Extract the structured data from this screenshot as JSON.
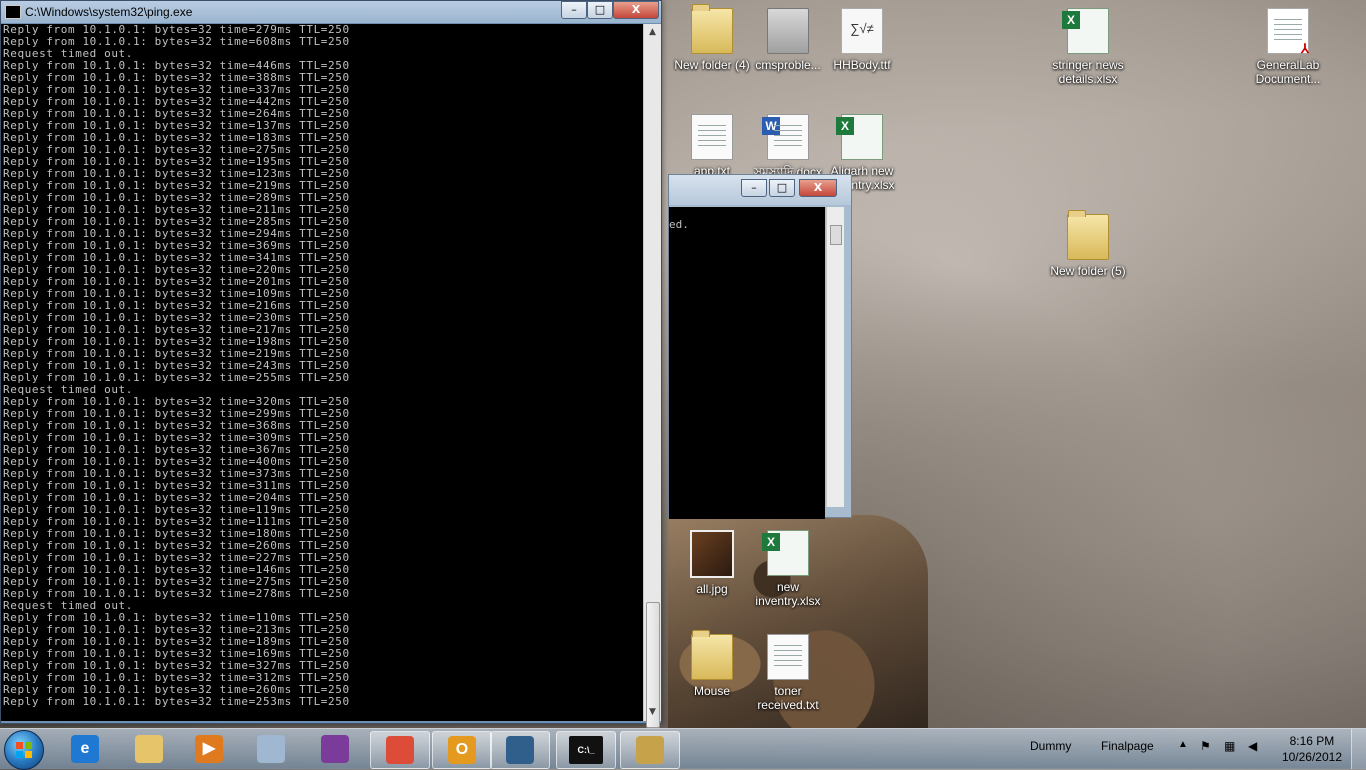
{
  "main_window": {
    "title": "C:\\Windows\\system32\\ping.exe",
    "minimize": "–",
    "maximize": "□",
    "close": "X",
    "lines": [
      "Reply from 10.1.0.1: bytes=32 time=279ms TTL=250",
      "Reply from 10.1.0.1: bytes=32 time=608ms TTL=250",
      "Request timed out.",
      "Reply from 10.1.0.1: bytes=32 time=446ms TTL=250",
      "Reply from 10.1.0.1: bytes=32 time=388ms TTL=250",
      "Reply from 10.1.0.1: bytes=32 time=337ms TTL=250",
      "Reply from 10.1.0.1: bytes=32 time=442ms TTL=250",
      "Reply from 10.1.0.1: bytes=32 time=264ms TTL=250",
      "Reply from 10.1.0.1: bytes=32 time=137ms TTL=250",
      "Reply from 10.1.0.1: bytes=32 time=183ms TTL=250",
      "Reply from 10.1.0.1: bytes=32 time=275ms TTL=250",
      "Reply from 10.1.0.1: bytes=32 time=195ms TTL=250",
      "Reply from 10.1.0.1: bytes=32 time=123ms TTL=250",
      "Reply from 10.1.0.1: bytes=32 time=219ms TTL=250",
      "Reply from 10.1.0.1: bytes=32 time=289ms TTL=250",
      "Reply from 10.1.0.1: bytes=32 time=211ms TTL=250",
      "Reply from 10.1.0.1: bytes=32 time=285ms TTL=250",
      "Reply from 10.1.0.1: bytes=32 time=294ms TTL=250",
      "Reply from 10.1.0.1: bytes=32 time=369ms TTL=250",
      "Reply from 10.1.0.1: bytes=32 time=341ms TTL=250",
      "Reply from 10.1.0.1: bytes=32 time=220ms TTL=250",
      "Reply from 10.1.0.1: bytes=32 time=201ms TTL=250",
      "Reply from 10.1.0.1: bytes=32 time=109ms TTL=250",
      "Reply from 10.1.0.1: bytes=32 time=216ms TTL=250",
      "Reply from 10.1.0.1: bytes=32 time=230ms TTL=250",
      "Reply from 10.1.0.1: bytes=32 time=217ms TTL=250",
      "Reply from 10.1.0.1: bytes=32 time=198ms TTL=250",
      "Reply from 10.1.0.1: bytes=32 time=219ms TTL=250",
      "Reply from 10.1.0.1: bytes=32 time=243ms TTL=250",
      "Reply from 10.1.0.1: bytes=32 time=255ms TTL=250",
      "Request timed out.",
      "Reply from 10.1.0.1: bytes=32 time=320ms TTL=250",
      "Reply from 10.1.0.1: bytes=32 time=299ms TTL=250",
      "Reply from 10.1.0.1: bytes=32 time=368ms TTL=250",
      "Reply from 10.1.0.1: bytes=32 time=309ms TTL=250",
      "Reply from 10.1.0.1: bytes=32 time=367ms TTL=250",
      "Reply from 10.1.0.1: bytes=32 time=400ms TTL=250",
      "Reply from 10.1.0.1: bytes=32 time=373ms TTL=250",
      "Reply from 10.1.0.1: bytes=32 time=311ms TTL=250",
      "Reply from 10.1.0.1: bytes=32 time=204ms TTL=250",
      "Reply from 10.1.0.1: bytes=32 time=119ms TTL=250",
      "Reply from 10.1.0.1: bytes=32 time=111ms TTL=250",
      "Reply from 10.1.0.1: bytes=32 time=180ms TTL=250",
      "Reply from 10.1.0.1: bytes=32 time=260ms TTL=250",
      "Reply from 10.1.0.1: bytes=32 time=227ms TTL=250",
      "Reply from 10.1.0.1: bytes=32 time=146ms TTL=250",
      "Reply from 10.1.0.1: bytes=32 time=275ms TTL=250",
      "Reply from 10.1.0.1: bytes=32 time=278ms TTL=250",
      "Request timed out.",
      "Reply from 10.1.0.1: bytes=32 time=110ms TTL=250",
      "Reply from 10.1.0.1: bytes=32 time=213ms TTL=250",
      "Reply from 10.1.0.1: bytes=32 time=189ms TTL=250",
      "Reply from 10.1.0.1: bytes=32 time=169ms TTL=250",
      "Reply from 10.1.0.1: bytes=32 time=327ms TTL=250",
      "Reply from 10.1.0.1: bytes=32 time=312ms TTL=250",
      "Reply from 10.1.0.1: bytes=32 time=260ms TTL=250",
      "Reply from 10.1.0.1: bytes=32 time=253ms TTL=250"
    ]
  },
  "second_window": {
    "minimize": "–",
    "maximize": "□",
    "close": "X",
    "text": "ed."
  },
  "desktop_icons": [
    {
      "label": "New folder (4)",
      "type": "folder"
    },
    {
      "label": "cmsproble...",
      "type": "drive"
    },
    {
      "label": "HHBody.ttf",
      "type": "ttf",
      "glyph": "∑√≠"
    },
    {
      "label": "stringer news details.xlsx",
      "type": "xls"
    },
    {
      "label": "GeneralLab Document...",
      "type": "pdf"
    },
    {
      "label": "app.txt",
      "type": "doc"
    },
    {
      "label": "সমস্যাদি.docx",
      "type": "docx"
    },
    {
      "label": "Aligarh new inventry.xlsx",
      "type": "xls"
    },
    {
      "label": "New folder (5)",
      "type": "folder"
    },
    {
      "label": "all.jpg",
      "type": "image"
    },
    {
      "label": "new inventry.xlsx",
      "type": "xls"
    },
    {
      "label": "Mouse",
      "type": "folder"
    },
    {
      "label": "toner received.txt",
      "type": "doc"
    }
  ],
  "taskbar": {
    "pinned": [
      {
        "name": "internet-explorer",
        "glyph": "e",
        "color": "#1f78d1"
      },
      {
        "name": "file-explorer",
        "glyph": "",
        "color": "#e5c46a"
      },
      {
        "name": "media-player",
        "glyph": "▶",
        "color": "#e07a1e"
      },
      {
        "name": "notepad-app",
        "glyph": "",
        "color": "#9fb7d0"
      },
      {
        "name": "winrar-app",
        "glyph": "",
        "color": "#7a3b9a"
      },
      {
        "name": "chrome-browser",
        "glyph": "",
        "color": "#dd4b39"
      },
      {
        "name": "outlook-app",
        "glyph": "O",
        "color": "#e39a1f"
      },
      {
        "name": "window-app",
        "glyph": "",
        "color": "#2f5f8a"
      },
      {
        "name": "command-prompt",
        "glyph": "C:\\_",
        "color": "#111111"
      },
      {
        "name": "paint-app",
        "glyph": "",
        "color": "#c6a34a"
      }
    ],
    "toolbar_dummy": "Dummy",
    "toolbar_finalpage": "Finalpage",
    "tray_chevron": "▲",
    "time": "8:16 PM",
    "date": "10/26/2012"
  }
}
